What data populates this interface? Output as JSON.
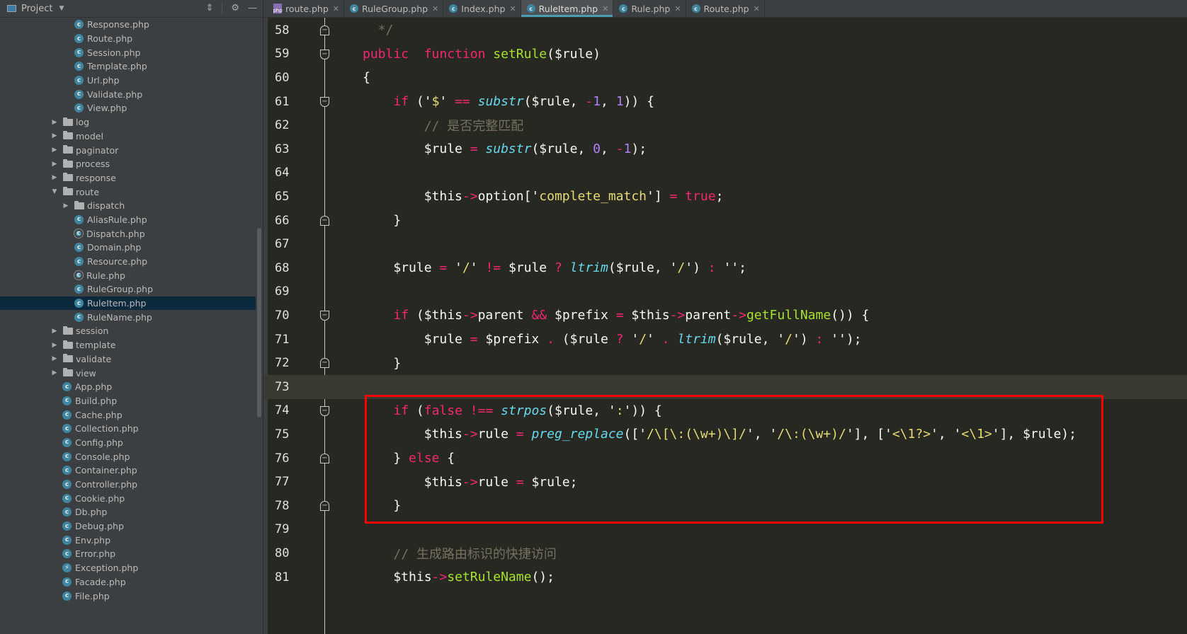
{
  "sidebar": {
    "title": "Project",
    "tree": [
      {
        "name": "Response.php",
        "type": "class",
        "depth": 3
      },
      {
        "name": "Route.php",
        "type": "class",
        "depth": 3
      },
      {
        "name": "Session.php",
        "type": "class",
        "depth": 3
      },
      {
        "name": "Template.php",
        "type": "class",
        "depth": 3
      },
      {
        "name": "Url.php",
        "type": "class",
        "depth": 3
      },
      {
        "name": "Validate.php",
        "type": "class",
        "depth": 3
      },
      {
        "name": "View.php",
        "type": "class",
        "depth": 3
      },
      {
        "name": "log",
        "type": "folder",
        "depth": 2,
        "expanded": false
      },
      {
        "name": "model",
        "type": "folder",
        "depth": 2,
        "expanded": false
      },
      {
        "name": "paginator",
        "type": "folder",
        "depth": 2,
        "expanded": false
      },
      {
        "name": "process",
        "type": "folder",
        "depth": 2,
        "expanded": false
      },
      {
        "name": "response",
        "type": "folder",
        "depth": 2,
        "expanded": false
      },
      {
        "name": "route",
        "type": "folder",
        "depth": 2,
        "expanded": true
      },
      {
        "name": "dispatch",
        "type": "folder",
        "depth": 3,
        "expanded": false
      },
      {
        "name": "AliasRule.php",
        "type": "class",
        "depth": 3
      },
      {
        "name": "Dispatch.php",
        "type": "abstract",
        "depth": 3
      },
      {
        "name": "Domain.php",
        "type": "class",
        "depth": 3
      },
      {
        "name": "Resource.php",
        "type": "class",
        "depth": 3
      },
      {
        "name": "Rule.php",
        "type": "abstract",
        "depth": 3
      },
      {
        "name": "RuleGroup.php",
        "type": "class",
        "depth": 3
      },
      {
        "name": "RuleItem.php",
        "type": "class",
        "depth": 3,
        "selected": true
      },
      {
        "name": "RuleName.php",
        "type": "class",
        "depth": 3
      },
      {
        "name": "session",
        "type": "folder",
        "depth": 2,
        "expanded": false
      },
      {
        "name": "template",
        "type": "folder",
        "depth": 2,
        "expanded": false
      },
      {
        "name": "validate",
        "type": "folder",
        "depth": 2,
        "expanded": false
      },
      {
        "name": "view",
        "type": "folder",
        "depth": 2,
        "expanded": false
      },
      {
        "name": "App.php",
        "type": "class",
        "depth": 2
      },
      {
        "name": "Build.php",
        "type": "class",
        "depth": 2
      },
      {
        "name": "Cache.php",
        "type": "class",
        "depth": 2
      },
      {
        "name": "Collection.php",
        "type": "class",
        "depth": 2
      },
      {
        "name": "Config.php",
        "type": "class",
        "depth": 2
      },
      {
        "name": "Console.php",
        "type": "class",
        "depth": 2
      },
      {
        "name": "Container.php",
        "type": "class",
        "depth": 2
      },
      {
        "name": "Controller.php",
        "type": "class",
        "depth": 2
      },
      {
        "name": "Cookie.php",
        "type": "class",
        "depth": 2
      },
      {
        "name": "Db.php",
        "type": "class",
        "depth": 2
      },
      {
        "name": "Debug.php",
        "type": "class",
        "depth": 2
      },
      {
        "name": "Env.php",
        "type": "class",
        "depth": 2
      },
      {
        "name": "Error.php",
        "type": "class",
        "depth": 2
      },
      {
        "name": "Exception.php",
        "type": "exception",
        "depth": 2
      },
      {
        "name": "Facade.php",
        "type": "class",
        "depth": 2
      },
      {
        "name": "File.php",
        "type": "class",
        "depth": 2
      }
    ]
  },
  "tabs": [
    {
      "label": "route.php",
      "icon": "php-file-icon",
      "active": false
    },
    {
      "label": "RuleGroup.php",
      "icon": "class-icon",
      "active": false
    },
    {
      "label": "Index.php",
      "icon": "class-icon",
      "active": false
    },
    {
      "label": "RuleItem.php",
      "icon": "class-icon",
      "active": true
    },
    {
      "label": "Rule.php",
      "icon": "abstract-class-icon",
      "active": false
    },
    {
      "label": "Route.php",
      "icon": "class-icon",
      "active": false
    }
  ],
  "editor": {
    "current_line": 73,
    "lines": [
      {
        "n": "58",
        "fold": "end",
        "tokens": [
          [
            "cm",
            "  */"
          ]
        ]
      },
      {
        "n": "59",
        "fold": "open",
        "tokens": [
          [
            "kw",
            "public"
          ],
          [
            "",
            "  "
          ],
          [
            "kw",
            "function"
          ],
          [
            "",
            " "
          ],
          [
            "fn",
            "setRule"
          ],
          [
            "",
            "($rule)"
          ]
        ]
      },
      {
        "n": "60",
        "tokens": [
          [
            "",
            "{"
          ]
        ]
      },
      {
        "n": "61",
        "fold": "open",
        "tokens": [
          [
            "",
            "    "
          ],
          [
            "kw",
            "if"
          ],
          [
            "",
            " ('"
          ],
          [
            "str",
            "$"
          ],
          [
            "",
            "' "
          ],
          [
            "op",
            "=="
          ],
          [
            "",
            " "
          ],
          [
            "bi",
            "substr"
          ],
          [
            "",
            "($rule, "
          ],
          [
            "op",
            "-"
          ],
          [
            "num",
            "1"
          ],
          [
            "",
            ", "
          ],
          [
            "num",
            "1"
          ],
          [
            "",
            ")) {"
          ]
        ]
      },
      {
        "n": "62",
        "tokens": [
          [
            "",
            "        "
          ],
          [
            "cm",
            "// 是否完整匹配"
          ]
        ]
      },
      {
        "n": "63",
        "tokens": [
          [
            "",
            "        $rule "
          ],
          [
            "op",
            "="
          ],
          [
            "",
            " "
          ],
          [
            "bi",
            "substr"
          ],
          [
            "",
            "($rule, "
          ],
          [
            "num",
            "0"
          ],
          [
            "",
            ", "
          ],
          [
            "op",
            "-"
          ],
          [
            "num",
            "1"
          ],
          [
            "",
            ");"
          ]
        ]
      },
      {
        "n": "64",
        "tokens": []
      },
      {
        "n": "65",
        "tokens": [
          [
            "",
            "        $this"
          ],
          [
            "op",
            "->"
          ],
          [
            "",
            "option['"
          ],
          [
            "str",
            "complete_match"
          ],
          [
            "",
            "'] "
          ],
          [
            "op",
            "="
          ],
          [
            "",
            " "
          ],
          [
            "kw",
            "true"
          ],
          [
            "",
            ";"
          ]
        ]
      },
      {
        "n": "66",
        "fold": "end",
        "tokens": [
          [
            "",
            "    }"
          ]
        ]
      },
      {
        "n": "67",
        "tokens": []
      },
      {
        "n": "68",
        "tokens": [
          [
            "",
            "    $rule "
          ],
          [
            "op",
            "="
          ],
          [
            "",
            " '"
          ],
          [
            "str",
            "/"
          ],
          [
            "",
            "' "
          ],
          [
            "op",
            "!="
          ],
          [
            "",
            " $rule "
          ],
          [
            "op",
            "?"
          ],
          [
            "",
            " "
          ],
          [
            "bi",
            "ltrim"
          ],
          [
            "",
            "($rule, '"
          ],
          [
            "str",
            "/"
          ],
          [
            "",
            "') "
          ],
          [
            "op",
            ":"
          ],
          [
            "",
            " '';"
          ]
        ]
      },
      {
        "n": "69",
        "tokens": []
      },
      {
        "n": "70",
        "fold": "open",
        "tokens": [
          [
            "",
            "    "
          ],
          [
            "kw",
            "if"
          ],
          [
            "",
            " ($this"
          ],
          [
            "op",
            "->"
          ],
          [
            "",
            "parent "
          ],
          [
            "op",
            "&&"
          ],
          [
            "",
            " $prefix "
          ],
          [
            "op",
            "="
          ],
          [
            "",
            " $this"
          ],
          [
            "op",
            "->"
          ],
          [
            "",
            "parent"
          ],
          [
            "op",
            "->"
          ],
          [
            "fn",
            "getFullName"
          ],
          [
            "",
            "()) {"
          ]
        ]
      },
      {
        "n": "71",
        "tokens": [
          [
            "",
            "        $rule "
          ],
          [
            "op",
            "="
          ],
          [
            "",
            " $prefix "
          ],
          [
            "op",
            "."
          ],
          [
            "",
            " ($rule "
          ],
          [
            "op",
            "?"
          ],
          [
            "",
            " '"
          ],
          [
            "str",
            "/"
          ],
          [
            "",
            "' "
          ],
          [
            "op",
            "."
          ],
          [
            "",
            " "
          ],
          [
            "bi",
            "ltrim"
          ],
          [
            "",
            "($rule, '"
          ],
          [
            "str",
            "/"
          ],
          [
            "",
            "') "
          ],
          [
            "op",
            ":"
          ],
          [
            "",
            " '');"
          ]
        ]
      },
      {
        "n": "72",
        "fold": "end",
        "tokens": [
          [
            "",
            "    }"
          ]
        ]
      },
      {
        "n": "73",
        "tokens": []
      },
      {
        "n": "74",
        "fold": "open",
        "tokens": [
          [
            "",
            "    "
          ],
          [
            "kw",
            "if"
          ],
          [
            "",
            " ("
          ],
          [
            "kw",
            "false"
          ],
          [
            "",
            " "
          ],
          [
            "op",
            "!=="
          ],
          [
            "",
            " "
          ],
          [
            "bi",
            "strpos"
          ],
          [
            "",
            "($rule, '"
          ],
          [
            "str",
            ":"
          ],
          [
            "",
            "')) {"
          ]
        ]
      },
      {
        "n": "75",
        "tokens": [
          [
            "",
            "        $this"
          ],
          [
            "op",
            "->"
          ],
          [
            "",
            "rule "
          ],
          [
            "op",
            "="
          ],
          [
            "",
            " "
          ],
          [
            "bi",
            "preg_replace"
          ],
          [
            "",
            "(['"
          ],
          [
            "str",
            "/\\[\\:(\\w+)\\]/"
          ],
          [
            "",
            "', '"
          ],
          [
            "str",
            "/\\:(\\w+)/"
          ],
          [
            "",
            "'], ['"
          ],
          [
            "str",
            "<\\1?>"
          ],
          [
            "",
            "', '"
          ],
          [
            "str",
            "<\\1>"
          ],
          [
            "",
            "'], $rule);"
          ]
        ]
      },
      {
        "n": "76",
        "fold": "end",
        "tokens": [
          [
            "",
            "    } "
          ],
          [
            "kw",
            "else"
          ],
          [
            "",
            " {"
          ]
        ]
      },
      {
        "n": "77",
        "tokens": [
          [
            "",
            "        $this"
          ],
          [
            "op",
            "->"
          ],
          [
            "",
            "rule "
          ],
          [
            "op",
            "="
          ],
          [
            "",
            " $rule;"
          ]
        ]
      },
      {
        "n": "78",
        "fold": "end",
        "tokens": [
          [
            "",
            "    }"
          ]
        ]
      },
      {
        "n": "79",
        "tokens": []
      },
      {
        "n": "80",
        "tokens": [
          [
            "",
            "    "
          ],
          [
            "cm",
            "// 生成路由标识的快捷访问"
          ]
        ]
      },
      {
        "n": "81",
        "tokens": [
          [
            "",
            "    $this"
          ],
          [
            "op",
            "->"
          ],
          [
            "fn",
            "setRuleName"
          ],
          [
            "",
            "();"
          ]
        ]
      }
    ]
  },
  "annotation": {
    "color": "#ff0000",
    "from_line": 74,
    "to_line": 78
  }
}
